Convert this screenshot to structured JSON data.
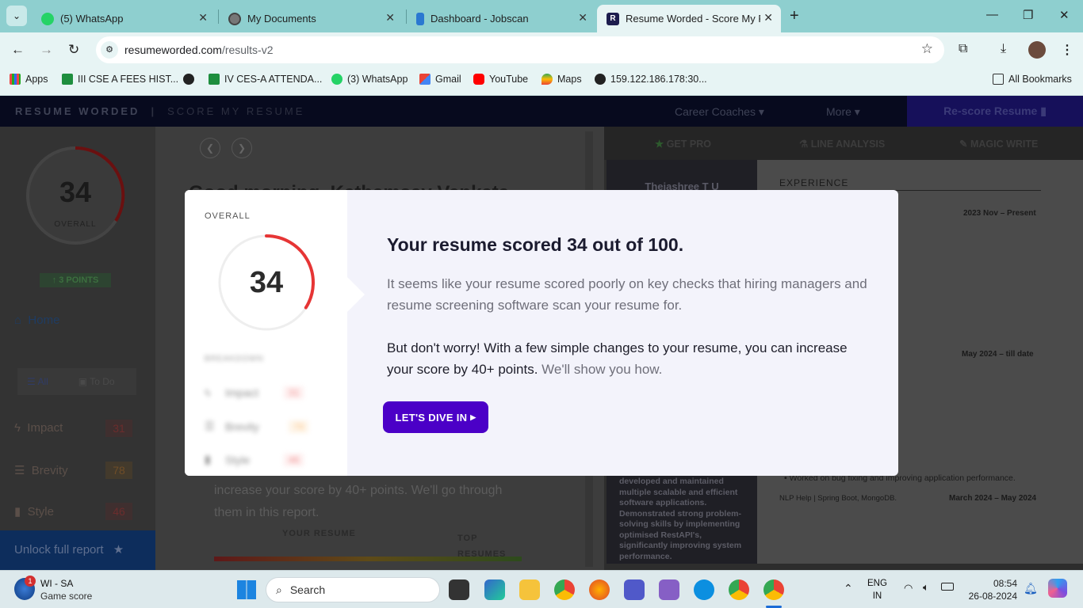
{
  "browser": {
    "tabs": [
      {
        "title": "(5) WhatsApp",
        "favicon": "whatsapp-icon",
        "color": "#25d366"
      },
      {
        "title": "My Documents",
        "favicon": "globe-icon",
        "color": "#777777"
      },
      {
        "title": "Dashboard - Jobscan",
        "favicon": "jobscan-icon",
        "color": "#2a78d1"
      },
      {
        "title": "Resume Worded - Score My Re",
        "favicon": "resume-worded-icon",
        "color": "#1d1d4e",
        "active": true
      }
    ],
    "url_host": "resumeworded.com",
    "url_path": "/results-v2",
    "bookmarks": [
      {
        "label": "Apps",
        "icon": "apps-grid-icon"
      },
      {
        "label": "III CSE A FEES HIST...",
        "icon": "sheets-icon"
      },
      {
        "label": "",
        "icon": "globe-icon"
      },
      {
        "label": "IV CES-A ATTENDA...",
        "icon": "sheets-icon"
      },
      {
        "label": "(3) WhatsApp",
        "icon": "whatsapp-icon"
      },
      {
        "label": "Gmail",
        "icon": "gmail-icon"
      },
      {
        "label": "YouTube",
        "icon": "youtube-icon"
      },
      {
        "label": "Maps",
        "icon": "maps-icon"
      },
      {
        "label": "159.122.186.178:30...",
        "icon": "globe-icon"
      }
    ],
    "all_bookmarks": "All Bookmarks"
  },
  "site": {
    "brand": "RESUME WORDED",
    "section": "SCORE MY RESUME",
    "nav_career": "Career Coaches",
    "nav_more": "More",
    "rescore": "Re-score Resume",
    "right_tabs": [
      "GET PRO",
      "LINE ANALYSIS",
      "MAGIC WRITE"
    ]
  },
  "sidebar": {
    "score": "34",
    "overall": "OVERALL",
    "points": "3 POINTS",
    "home": "Home",
    "filter_all": "All",
    "filter_todo": "To Do",
    "items": [
      {
        "label": "Impact",
        "value": "31"
      },
      {
        "label": "Brevity",
        "value": "78"
      },
      {
        "label": "Style",
        "value": "46"
      }
    ],
    "unlock": "Unlock full report"
  },
  "background": {
    "greeting": "Good morning, Kathamsay Venkata",
    "body_line1": "increase your score by 40+ points. We'll go through",
    "body_line2": "them in this report.",
    "your_resume": "YOUR RESUME",
    "top_resumes": "TOP RESUMES"
  },
  "resume_preview": {
    "name": "Thejashree T U",
    "experience": "EXPERIENCE",
    "date1": "2023 Nov – Present",
    "date2": "May 2024 – till date",
    "project": "NLP Help | Spring Boot, MongoDB.",
    "date3": "March 2024 – May 2024",
    "bullet": "Worked on bug fixing and improving application performance."
  },
  "modal": {
    "overall_label": "OVERALL",
    "score": "34",
    "score_fraction": 0.34,
    "breakdown_label": "BREAKDOWN",
    "breakdown": [
      {
        "label": "Impact",
        "value": "31",
        "color": "#e54646"
      },
      {
        "label": "Brevity",
        "value": "78",
        "color": "#f5a340"
      },
      {
        "label": "Style",
        "value": "46",
        "color": "#e54646"
      }
    ],
    "headline": "Your resume scored 34 out of 100.",
    "paragraph1": "It seems like your resume scored poorly on key checks that hiring managers and resume screening software scan your resume for.",
    "paragraph2": "But don't worry! With a few simple changes to your resume, you can increase your score by 40+ points.",
    "paragraph2_tail": " We'll show you how.",
    "cta": "LET'S DIVE IN"
  },
  "taskbar": {
    "notif_count": "1",
    "weather_title": "WI - SA",
    "weather_sub": "Game score",
    "search": "Search",
    "lang1": "ENG",
    "lang2": "IN",
    "time": "08:54",
    "date": "26-08-2024"
  }
}
